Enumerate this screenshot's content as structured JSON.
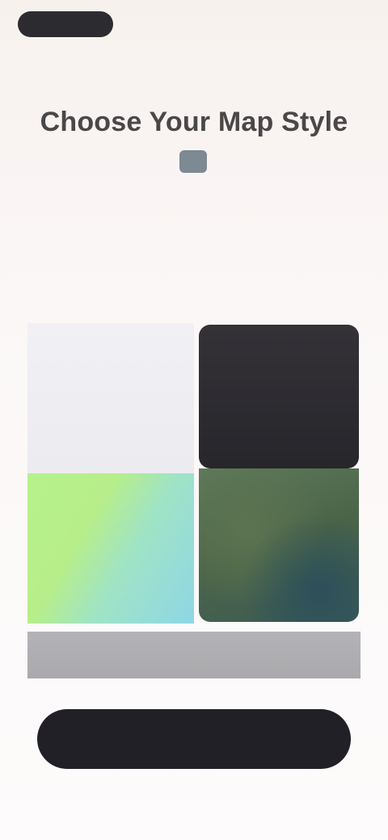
{
  "header": {
    "back_label": "",
    "right_text": ""
  },
  "eyebrow": "",
  "title": "Choose Your Map Style",
  "subtitle": "",
  "map_styles": [
    {
      "label": ""
    },
    {
      "label": ""
    },
    {
      "label": ""
    },
    {
      "label": ""
    }
  ],
  "selection_caption": "",
  "primary_button_label": "",
  "colors": {
    "background": "#faf6f5",
    "primary_button": "#222027",
    "dark_tile": "#2c2b30",
    "hybrid_tile": "#b6f28c",
    "satellite_tile": "#4a6448"
  }
}
